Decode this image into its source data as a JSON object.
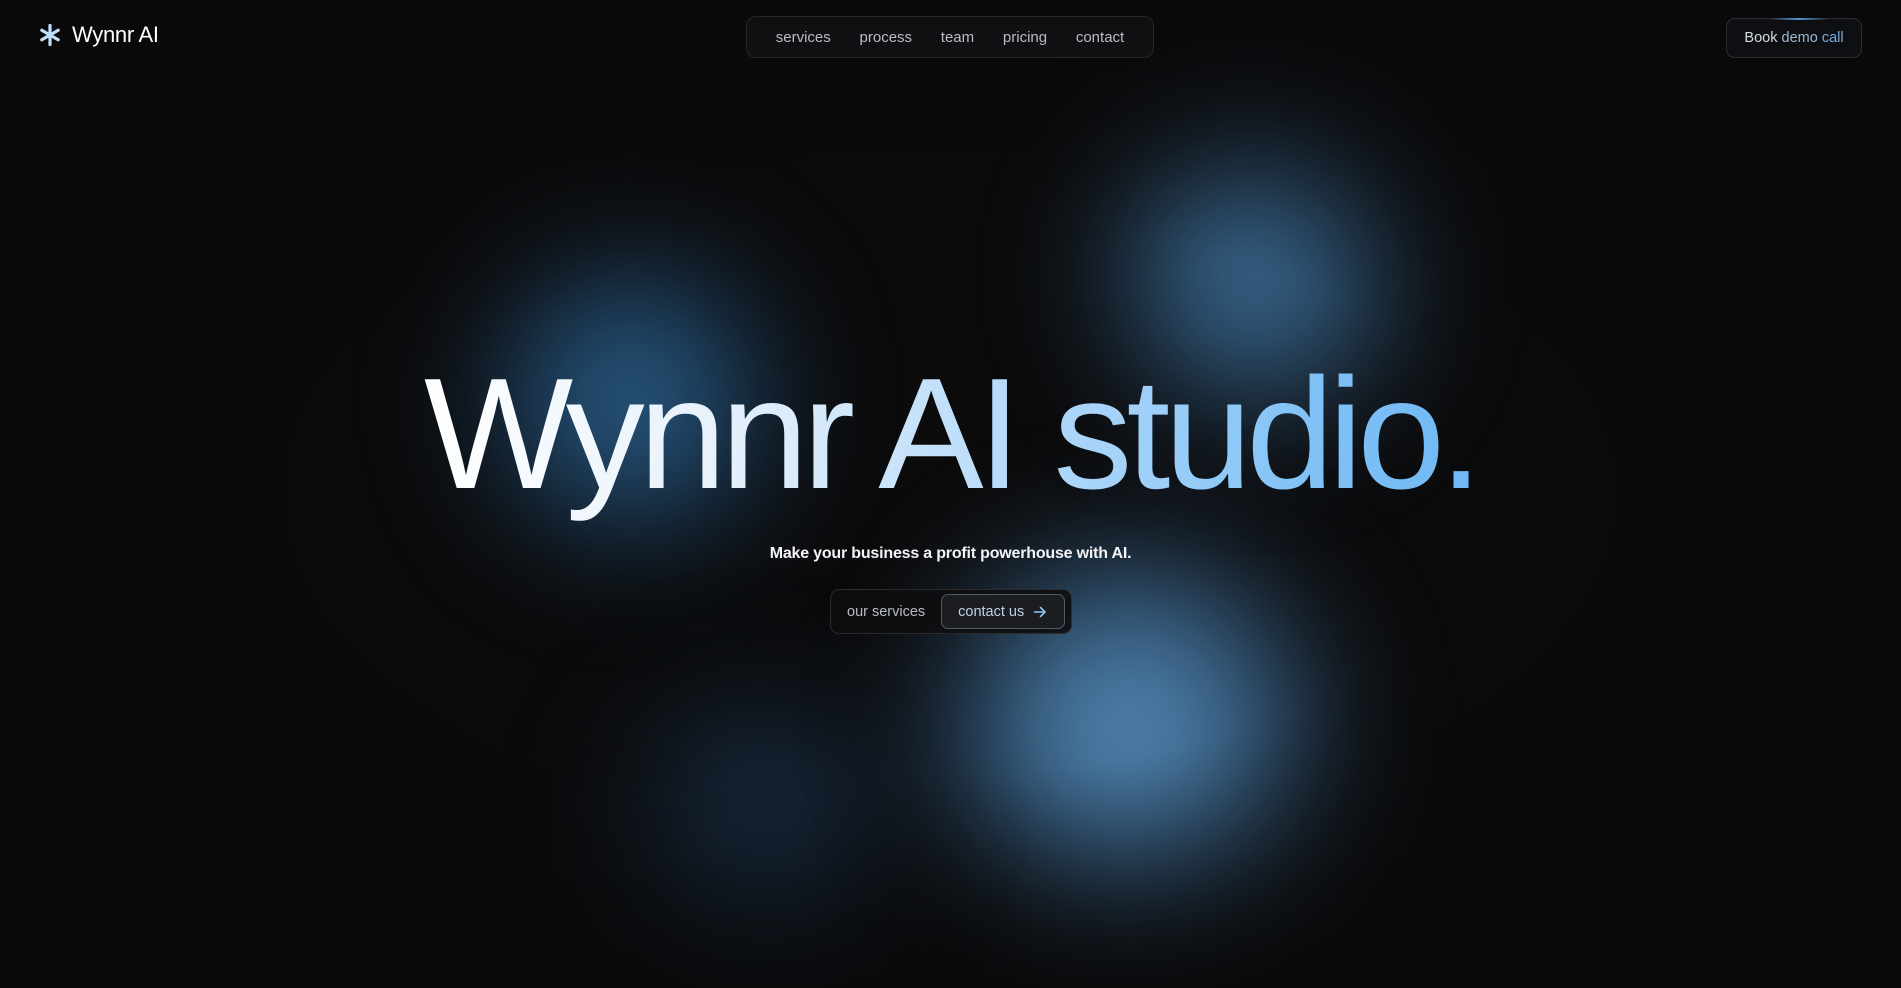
{
  "brand": {
    "name": "Wynnr AI",
    "icon": "asterisk-icon"
  },
  "nav": {
    "items": [
      {
        "label": "services"
      },
      {
        "label": "process"
      },
      {
        "label": "team"
      },
      {
        "label": "pricing"
      },
      {
        "label": "contact"
      }
    ]
  },
  "header": {
    "cta_part1": "Book",
    "cta_part2": "demo",
    "cta_part3": "call"
  },
  "hero": {
    "title": "Wynnr AI studio.",
    "subtitle": "Make your business a profit powerhouse with AI.",
    "secondary_action": "our services",
    "primary_action": "contact us",
    "primary_action_icon": "arrow-right-icon"
  },
  "colors": {
    "background": "#0b0b0c",
    "accent": "#78acdf",
    "accent_light": "#b8dbfa"
  }
}
